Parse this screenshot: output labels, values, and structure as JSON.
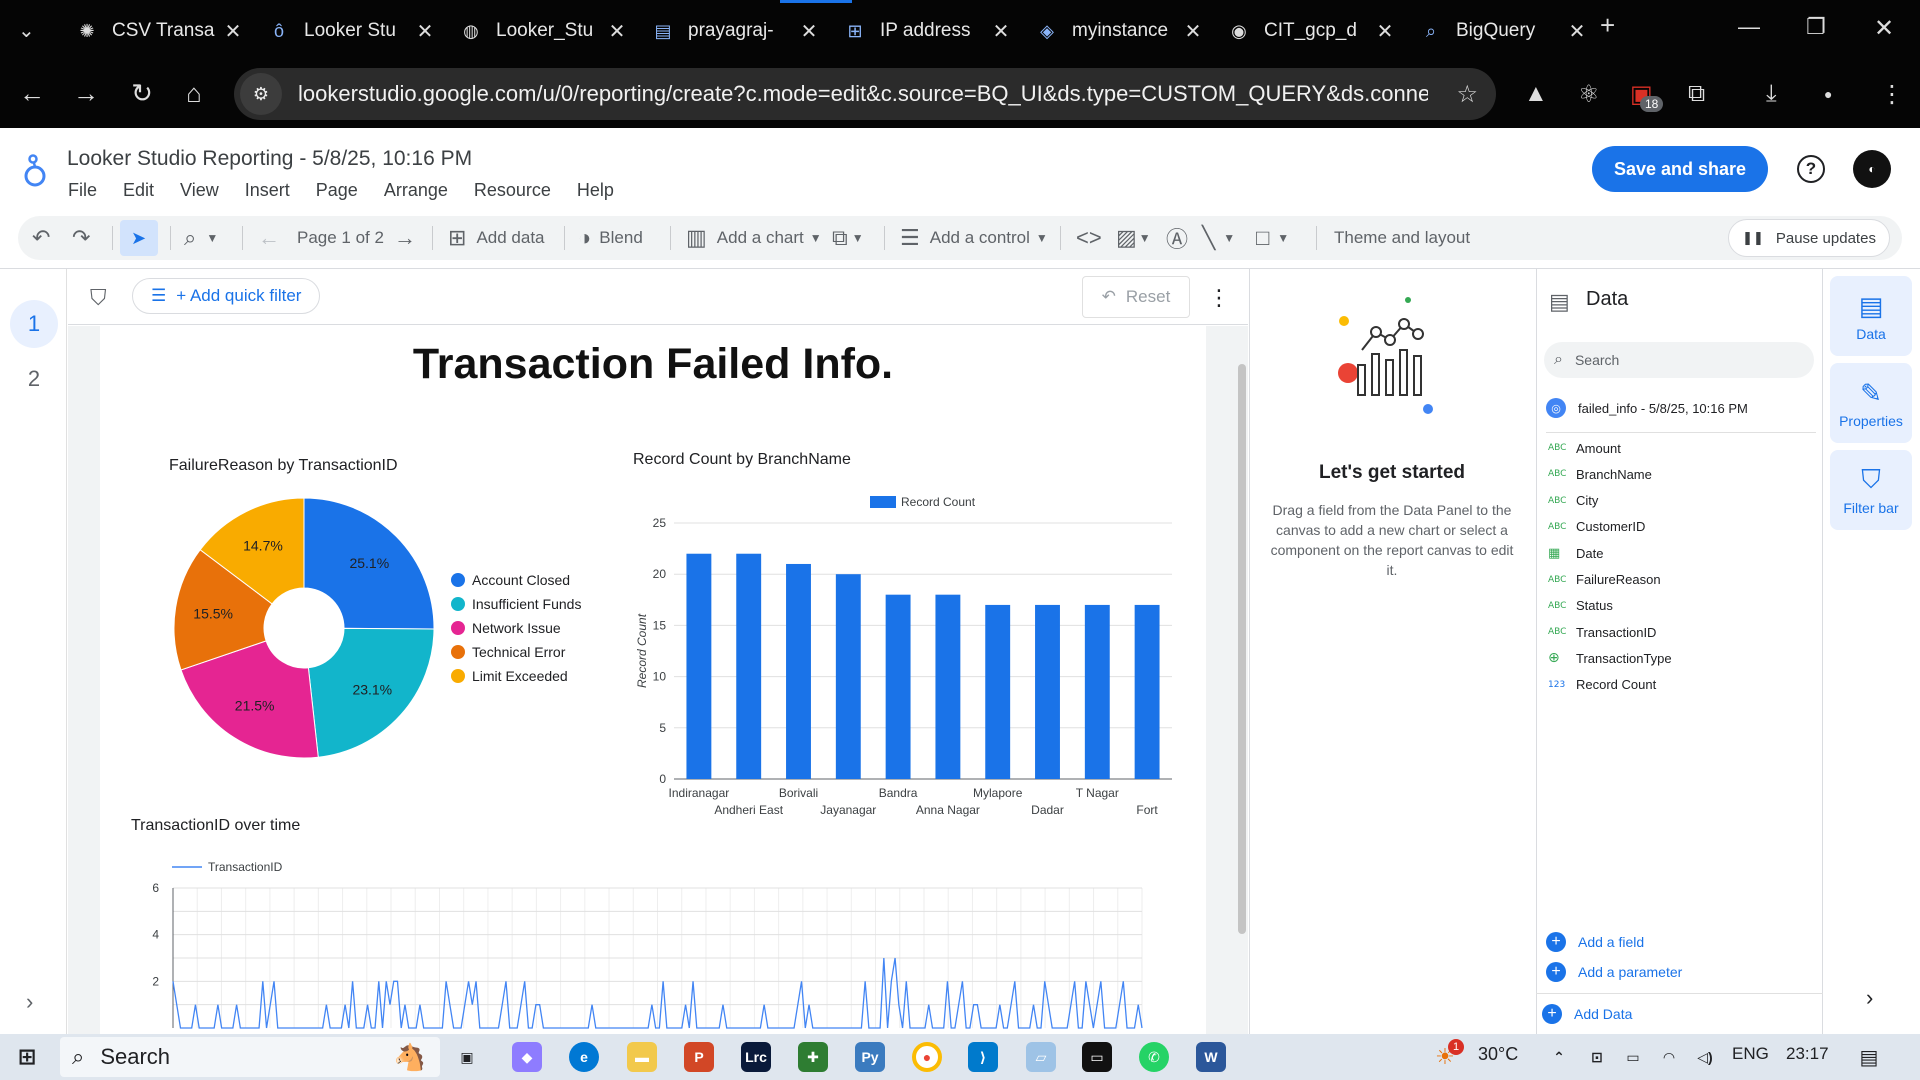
{
  "browser": {
    "tabs": [
      {
        "label": "CSV Transa",
        "icon": "openai-icon"
      },
      {
        "label": "Looker Stu",
        "icon": "looker-studio-icon"
      },
      {
        "label": "Looker_Stu",
        "icon": "globe-icon"
      },
      {
        "label": "prayagraj-",
        "icon": "dashboard-icon"
      },
      {
        "label": "IP address",
        "icon": "network-icon"
      },
      {
        "label": "myinstance",
        "icon": "layers-icon"
      },
      {
        "label": "CIT_gcp_d",
        "icon": "github-icon"
      },
      {
        "label": "BigQuery",
        "icon": "bigquery-icon"
      }
    ],
    "url": "lookerstudio.google.com/u/0/reporting/create?c.mode=edit&c.source=BQ_UI&ds.type=CUSTOM_QUERY&ds.connector...",
    "ext_badge": "18"
  },
  "app": {
    "title": "Looker Studio Reporting - 5/8/25, 10:16 PM",
    "menu": [
      "File",
      "Edit",
      "View",
      "Insert",
      "Page",
      "Arrange",
      "Resource",
      "Help"
    ],
    "save_label": "Save and share",
    "help": "?"
  },
  "toolbar": {
    "page_indicator": "Page 1 of 2",
    "add_data": "Add data",
    "blend": "Blend",
    "add_chart": "Add a chart",
    "add_control": "Add a control",
    "theme": "Theme and layout",
    "pause": "Pause updates"
  },
  "pages": [
    "1",
    "2"
  ],
  "filterbar": {
    "quick_filter": "+ Add quick filter",
    "reset": "Reset"
  },
  "report": {
    "heading": "Transaction Failed Info.",
    "pie_title": "FailureReason by TransactionID",
    "bar_title": "Record Count by BranchName",
    "line_title": "TransactionID over time"
  },
  "chart_data": [
    {
      "type": "pie",
      "title": "FailureReason by TransactionID",
      "categories": [
        "Account Closed",
        "Insufficient Funds",
        "Network Issue",
        "Technical Error",
        "Limit Exceeded"
      ],
      "values": [
        25.1,
        23.1,
        21.5,
        15.5,
        14.7
      ],
      "labels": [
        "25.1%",
        "23.1%",
        "21.5%",
        "15.5%",
        "14.7%"
      ],
      "colors": [
        "#1a73e8",
        "#12b5cb",
        "#e52592",
        "#e8710a",
        "#f9ab00"
      ],
      "legend": "right"
    },
    {
      "type": "bar",
      "title": "Record Count by BranchName",
      "categories": [
        "Indiranagar",
        "Andheri East",
        "Borivali",
        "Jayanagar",
        "Bandra",
        "Anna Nagar",
        "Mylapore",
        "Dadar",
        "T Nagar",
        "Fort"
      ],
      "series": [
        {
          "name": "Record Count",
          "values": [
            22,
            22,
            21,
            20,
            18,
            18,
            17,
            17,
            17,
            17
          ]
        }
      ],
      "ylabel": "Record Count",
      "ylim": [
        0,
        25
      ],
      "yticks": [
        "0",
        "5",
        "10",
        "15",
        "20",
        "25"
      ],
      "color": "#1a73e8",
      "legend": "top"
    },
    {
      "type": "line",
      "title": "TransactionID over time",
      "series": [
        {
          "name": "TransactionID",
          "values": [
            2,
            1,
            0,
            0,
            0,
            0,
            1,
            0,
            0,
            0,
            0,
            0,
            1,
            0,
            0,
            0,
            0,
            1,
            0,
            0,
            0,
            0,
            0,
            0,
            2,
            0,
            1,
            2,
            0,
            0,
            0,
            0,
            0,
            0,
            0,
            0,
            0,
            0,
            0,
            0,
            0,
            1,
            0,
            0,
            0,
            0,
            1,
            0,
            2,
            0,
            0,
            0,
            1,
            0,
            0,
            2,
            0,
            2,
            1,
            2,
            2,
            0,
            1,
            0,
            0,
            0,
            1,
            0,
            0,
            0,
            0,
            0,
            0,
            2,
            1,
            0,
            0,
            0,
            1,
            2,
            1,
            2,
            0,
            0,
            0,
            0,
            0,
            0,
            1,
            2,
            0,
            0,
            0,
            1,
            2,
            0,
            0,
            1,
            1,
            0,
            0,
            0,
            0,
            0,
            0,
            0,
            0,
            0,
            0,
            0,
            0,
            0,
            1,
            0,
            0,
            0,
            0,
            0,
            0,
            0,
            0,
            0,
            0,
            0,
            0,
            0,
            0,
            0,
            1,
            0,
            0,
            2,
            0,
            0,
            0,
            0,
            0,
            1,
            0,
            2,
            0,
            0,
            0,
            0,
            0,
            0,
            0,
            1,
            0,
            0,
            0,
            0,
            0,
            0,
            0,
            0,
            0,
            0,
            1,
            0,
            0,
            0,
            0,
            0,
            0,
            0,
            0,
            1,
            2,
            0,
            1,
            0,
            0,
            0,
            0,
            0,
            0,
            0,
            0,
            0,
            0,
            0,
            0,
            0,
            0,
            2,
            0,
            0,
            0,
            0,
            3,
            0,
            2,
            3,
            1,
            0,
            2,
            0,
            0,
            0,
            0,
            0,
            1,
            0,
            0,
            0,
            0,
            2,
            0,
            0,
            1,
            2,
            0,
            0,
            1,
            1,
            0,
            0,
            0,
            0,
            0,
            1,
            0,
            0,
            1,
            2,
            0,
            0,
            0,
            0,
            1,
            0,
            0,
            2,
            1,
            0,
            0,
            0,
            0,
            0,
            1,
            2,
            0,
            0,
            2,
            1,
            0,
            1,
            2,
            0,
            0,
            0,
            0,
            1,
            2,
            0,
            0,
            0,
            1,
            0
          ]
        }
      ],
      "ylim": [
        0,
        6
      ],
      "yticks": [
        "2",
        "4",
        "6"
      ],
      "color": "#4285f4",
      "legend": "top"
    }
  ],
  "get_started": {
    "title": "Let's get started",
    "text": "Drag a field from the Data Panel to the canvas to add a new chart or select a component on the report canvas to edit it."
  },
  "data_panel": {
    "title": "Data",
    "search_placeholder": "Search",
    "source": "failed_info - 5/8/25, 10:16 PM",
    "fields": [
      {
        "type": "ABC",
        "name": "Amount"
      },
      {
        "type": "ABC",
        "name": "BranchName"
      },
      {
        "type": "ABC",
        "name": "City"
      },
      {
        "type": "ABC",
        "name": "CustomerID"
      },
      {
        "type": "date",
        "name": "Date"
      },
      {
        "type": "ABC",
        "name": "FailureReason"
      },
      {
        "type": "ABC",
        "name": "Status"
      },
      {
        "type": "ABC",
        "name": "TransactionID"
      },
      {
        "type": "geo",
        "name": "TransactionType"
      },
      {
        "type": "123",
        "name": "Record Count"
      }
    ],
    "add_field": "Add a field",
    "add_parameter": "Add a parameter",
    "add_data": "Add Data"
  },
  "rail": {
    "data": "Data",
    "properties": "Properties",
    "filter_bar": "Filter bar"
  },
  "taskbar": {
    "search": "Search",
    "weather": "30°C",
    "weather_badge": "1",
    "lang": "ENG",
    "time": "23:17"
  }
}
